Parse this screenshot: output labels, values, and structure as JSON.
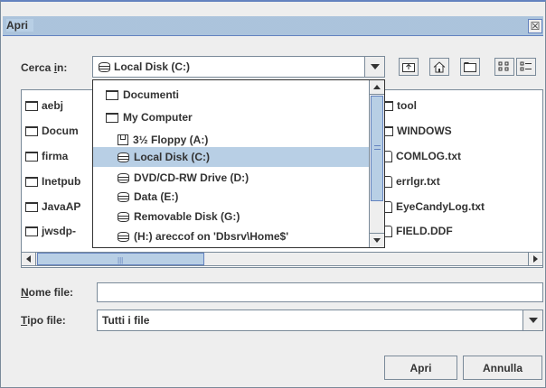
{
  "window": {
    "title": "Apri",
    "close_glyph": "☒"
  },
  "lookin": {
    "label_prefix": "Cerca ",
    "label_mnemonic": "i",
    "label_suffix": "n:",
    "selected": "Local Disk (C:)",
    "selected_icon": "disk-icon"
  },
  "toolbar": [
    {
      "name": "up-one-level-button",
      "icon": "up-folder-icon"
    },
    {
      "name": "home-button",
      "icon": "home-icon"
    },
    {
      "name": "new-folder-button",
      "icon": "new-folder-icon"
    },
    {
      "name": "list-view-button",
      "icon": "list-view-icon"
    },
    {
      "name": "details-view-button",
      "icon": "details-view-icon"
    }
  ],
  "files_left": [
    {
      "label": "aebj",
      "icon": "folder-icon"
    },
    {
      "label": "Docum",
      "icon": "folder-icon"
    },
    {
      "label": "firma",
      "icon": "folder-icon"
    },
    {
      "label": "Inetpub",
      "icon": "folder-icon"
    },
    {
      "label": "JavaAP",
      "icon": "folder-icon"
    },
    {
      "label": "jwsdp-",
      "icon": "folder-icon"
    }
  ],
  "files_right": [
    {
      "label": "tool",
      "icon": "folder-icon"
    },
    {
      "label": "WINDOWS",
      "icon": "folder-icon"
    },
    {
      "label": "COMLOG.txt",
      "icon": "file-icon"
    },
    {
      "label": "errlgr.txt",
      "icon": "file-icon"
    },
    {
      "label": "EyeCandyLog.txt",
      "icon": "file-icon"
    },
    {
      "label": "FIELD.DDF",
      "icon": "file-icon"
    }
  ],
  "dropdown": {
    "items": [
      {
        "label": "Documenti",
        "icon": "folder-icon",
        "selected": false
      },
      {
        "label": "My Computer",
        "icon": "computer-icon",
        "selected": false
      },
      {
        "label": "3½ Floppy (A:)",
        "icon": "floppy-icon",
        "selected": false
      },
      {
        "label": "Local Disk (C:)",
        "icon": "disk-icon",
        "selected": true
      },
      {
        "label": "DVD/CD-RW Drive (D:)",
        "icon": "disk-icon",
        "selected": false
      },
      {
        "label": "Data (E:)",
        "icon": "disk-icon",
        "selected": false
      },
      {
        "label": "Removable Disk (G:)",
        "icon": "disk-icon",
        "selected": false
      },
      {
        "label": "(H:) areccof on 'Dbsrv\\Home$'",
        "icon": "disk-icon",
        "selected": false
      }
    ]
  },
  "filename": {
    "label_mnemonic": "N",
    "label_rest": "ome file:",
    "value": ""
  },
  "filetype": {
    "label_mnemonic": "T",
    "label_rest": "ipo file:",
    "selected": "Tutti i file"
  },
  "buttons": {
    "open": "Apri",
    "cancel": "Annulla"
  },
  "colors": {
    "accent": "#b8cfe5",
    "accent_border": "#6382bf",
    "background": "#eeeeee"
  }
}
